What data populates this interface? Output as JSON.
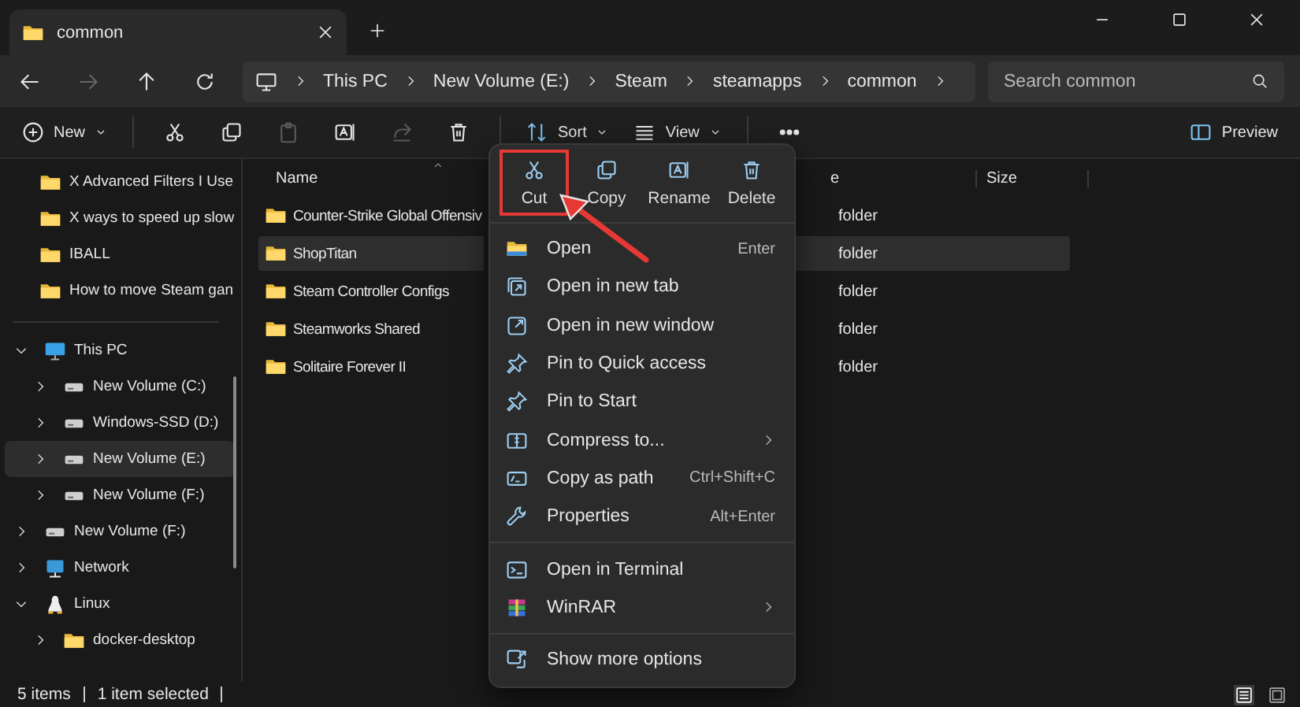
{
  "tab": {
    "title": "common"
  },
  "nav_buttons": [
    {
      "disabled": false
    },
    {
      "disabled": true
    },
    {
      "disabled": false
    },
    {
      "disabled": false
    }
  ],
  "address": {
    "segments": [
      "This PC",
      "New Volume (E:)",
      "Steam",
      "steamapps",
      "common"
    ]
  },
  "search": {
    "placeholder": "Search common"
  },
  "toolbar": {
    "new_label": "New",
    "icon_buttons": [
      {
        "disabled": false
      },
      {
        "disabled": false
      },
      {
        "disabled": true
      },
      {
        "disabled": false
      },
      {
        "disabled": true
      },
      {
        "disabled": false
      }
    ],
    "sort_label": "Sort",
    "view_label": "View",
    "preview_label": "Preview"
  },
  "sidebar": {
    "quick_access": [
      {
        "label": "X Advanced Filters I Use"
      },
      {
        "label": "X ways to speed up slow"
      },
      {
        "label": "IBALL"
      },
      {
        "label": "How to move Steam gan"
      }
    ],
    "tree": [
      {
        "label": "This PC",
        "kind": "pc",
        "expanded": true,
        "selected": false,
        "children": [
          {
            "label": "New Volume (C:)",
            "kind": "drive",
            "expanded": false,
            "selected": false
          },
          {
            "label": "Windows-SSD (D:)",
            "kind": "drive",
            "expanded": false,
            "selected": false
          },
          {
            "label": "New Volume (E:)",
            "kind": "drive",
            "expanded": false,
            "selected": true
          },
          {
            "label": "New Volume (F:)",
            "kind": "drive",
            "expanded": false,
            "selected": false
          }
        ]
      },
      {
        "label": "New Volume (F:)",
        "kind": "drive",
        "expanded": false,
        "selected": false
      },
      {
        "label": "Network",
        "kind": "network",
        "expanded": false,
        "selected": false
      },
      {
        "label": "Linux",
        "kind": "linux",
        "expanded": true,
        "selected": false,
        "children": [
          {
            "label": "docker-desktop",
            "kind": "folder",
            "expanded": false,
            "selected": false
          }
        ]
      }
    ]
  },
  "files": {
    "columns": [
      "Name",
      "e",
      "Size"
    ],
    "rows": [
      {
        "name": "Counter-Strike Global Offensiv",
        "type": "folder",
        "selected": false
      },
      {
        "name": "ShopTitan",
        "type": "folder",
        "selected": true
      },
      {
        "name": "Steam Controller Configs",
        "type": "folder",
        "selected": false
      },
      {
        "name": "Steamworks Shared",
        "type": "folder",
        "selected": false
      },
      {
        "name": "Solitaire Forever II",
        "type": "folder",
        "selected": false
      }
    ]
  },
  "context_menu": {
    "actions": [
      {
        "label": "Cut",
        "highlighted": true
      },
      {
        "label": "Copy",
        "highlighted": false
      },
      {
        "label": "Rename",
        "highlighted": false
      },
      {
        "label": "Delete",
        "highlighted": false
      }
    ],
    "sections": [
      {
        "items": [
          {
            "label": "Open",
            "shortcut": "Enter",
            "submenu": false
          },
          {
            "label": "Open in new tab",
            "submenu": false
          },
          {
            "label": "Open in new window",
            "submenu": false
          },
          {
            "label": "Pin to Quick access",
            "submenu": false
          },
          {
            "label": "Pin to Start",
            "submenu": false
          },
          {
            "label": "Compress to...",
            "submenu": true
          },
          {
            "label": "Copy as path",
            "shortcut": "Ctrl+Shift+C",
            "submenu": false
          },
          {
            "label": "Properties",
            "shortcut": "Alt+Enter",
            "submenu": false
          }
        ]
      },
      {
        "items": [
          {
            "label": "Open in Terminal",
            "submenu": false
          },
          {
            "label": "WinRAR",
            "submenu": true
          }
        ]
      },
      {
        "items": [
          {
            "label": "Show more options",
            "submenu": false
          }
        ]
      }
    ]
  },
  "status_bar": {
    "item_count": "5 items",
    "selection": "1 item selected",
    "views": [
      {
        "selected": true
      },
      {
        "selected": false
      }
    ]
  }
}
